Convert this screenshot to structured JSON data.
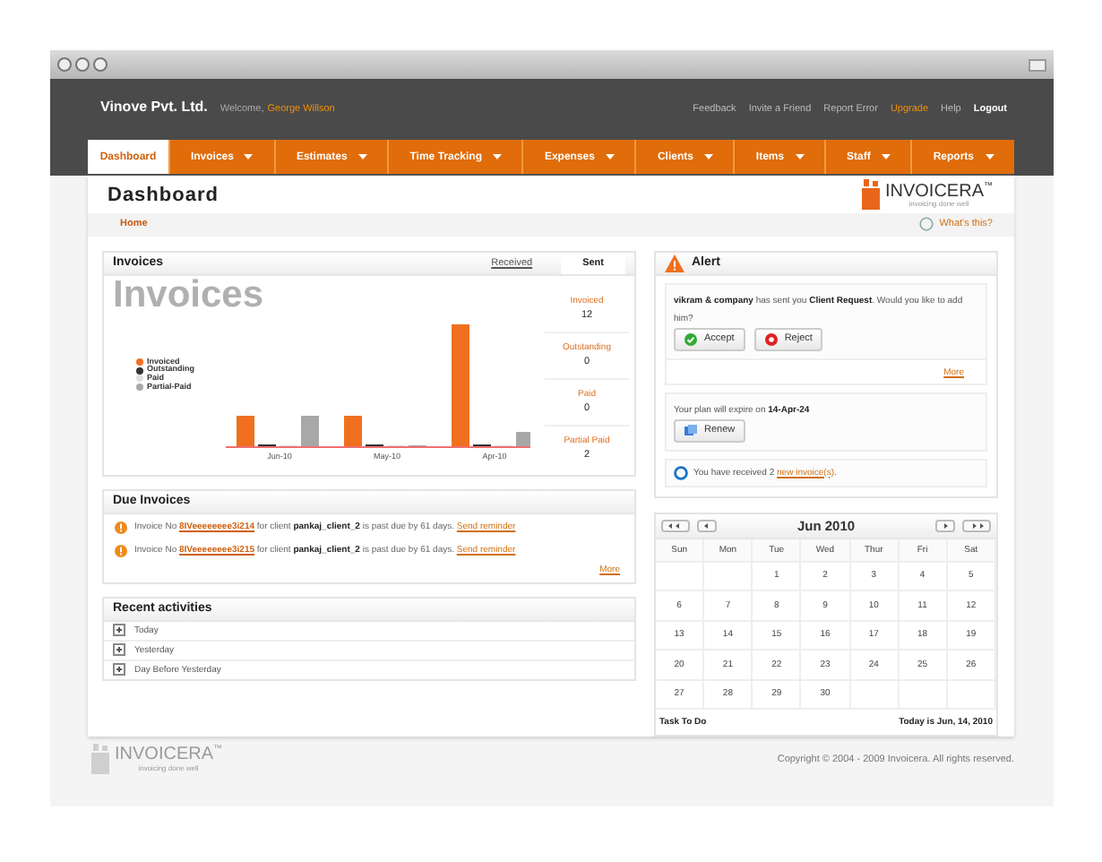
{
  "header": {
    "company": "Vinove Pvt. Ltd.",
    "welcome": "Welcome,",
    "user": "George Willson",
    "links": [
      {
        "label": "Feedback",
        "kind": "plain"
      },
      {
        "label": "Invite a Friend",
        "kind": "plain"
      },
      {
        "label": "Report Error",
        "kind": "plain"
      },
      {
        "label": "Upgrade",
        "kind": "accent"
      },
      {
        "label": "Help",
        "kind": "plain"
      },
      {
        "label": "Logout",
        "kind": "strong"
      }
    ]
  },
  "nav": [
    {
      "label": "Dashboard",
      "selected": true,
      "dropdown": false
    },
    {
      "label": "Invoices",
      "selected": false,
      "dropdown": true
    },
    {
      "label": "Estimates",
      "selected": false,
      "dropdown": true
    },
    {
      "label": "Time Tracking",
      "selected": false,
      "dropdown": true
    },
    {
      "label": "Expenses",
      "selected": false,
      "dropdown": true
    },
    {
      "label": "Clients",
      "selected": false,
      "dropdown": true
    },
    {
      "label": "Items",
      "selected": false,
      "dropdown": true
    },
    {
      "label": "Staff",
      "selected": false,
      "dropdown": true
    },
    {
      "label": "Reports",
      "selected": false,
      "dropdown": true
    }
  ],
  "page_title": "Dashboard",
  "logo": {
    "name": "INVOICERA",
    "tm": "™",
    "tagline": "invoicing done well"
  },
  "breadcrumb": "Home",
  "help_link": "What's this?",
  "invoices": {
    "title": "Invoices",
    "tabs": [
      {
        "label": "Received",
        "selected": false
      },
      {
        "label": "Sent",
        "selected": true
      }
    ],
    "chart": {
      "watermark": "Invoices",
      "categories": [
        "Jun-10",
        "May-10",
        "Apr-10"
      ],
      "legend": [
        {
          "label": "Invoiced",
          "color": "#f07020"
        },
        {
          "label": "Outstanding",
          "color": "#333333"
        },
        {
          "label": "Paid",
          "color": "#e0e0e0"
        },
        {
          "label": "Partial-Paid",
          "color": "#a8a8a8"
        }
      ]
    },
    "stats": [
      {
        "label": "Invoiced",
        "value": "12"
      },
      {
        "label": "Outstanding",
        "value": "0"
      },
      {
        "label": "Paid",
        "value": "0"
      },
      {
        "label": "Partial Paid",
        "value": "2"
      }
    ]
  },
  "due_invoices": {
    "title": "Due Invoices",
    "items": [
      {
        "prefix": "Invoice No",
        "invoice_no": "8IVeeeeeeee3i214",
        "text": "for client **pankaj_client_2** is past due by 61 days.",
        "action": "Send reminder"
      },
      {
        "prefix": "Invoice No",
        "invoice_no": "8IVeeeeeeee3i215",
        "text": "for client **pankaj_client_2** is past due by 61 days.",
        "action": "Send reminder"
      }
    ],
    "more": "More"
  },
  "recent": {
    "title": "Recent activities",
    "items": [
      {
        "label": "Today",
        "expanded": false
      },
      {
        "label": "Yesterday",
        "expanded": false
      },
      {
        "label": "Day Before Yesterday",
        "expanded": false
      }
    ]
  },
  "alert": {
    "title": "Alert",
    "message": "**vikram & company** has sent you **Client Request**. Would you like to add him?",
    "accept": "Accept",
    "reject": "Reject",
    "more": "More",
    "plan": "Your plan will expire on **14-Apr-24**",
    "renew": "Renew",
    "received_prefix": "You have received 2",
    "received_link": "new invoice(s)",
    "received_suffix": "."
  },
  "calendar": {
    "month": "Jun 2010",
    "weekdays": [
      "Sun",
      "Mon",
      "Tue",
      "Wed",
      "Thur",
      "Fri",
      "Sat"
    ],
    "weeks": [
      {
        "kind": "first",
        "days": [
          "1",
          "2",
          "3",
          "4",
          "5"
        ]
      },
      {
        "kind": "full",
        "days": [
          "6",
          "7",
          "8",
          "9",
          "10",
          "11",
          "12"
        ]
      },
      {
        "kind": "full",
        "days": [
          "13",
          "14",
          "15",
          "16",
          "17",
          "18",
          "19"
        ]
      },
      {
        "kind": "full",
        "days": [
          "20",
          "21",
          "22",
          "23",
          "24",
          "25",
          "26"
        ]
      },
      {
        "kind": "last",
        "days": [
          "27",
          "28",
          "29",
          "30"
        ]
      }
    ],
    "task_label": "Task To Do",
    "today": "Today is Jun, 14, 2010"
  },
  "footer": {
    "logo": "INVOICERA",
    "tm": "™",
    "tagline": "invoicing done well",
    "copyright": "Copyright © 2004 - 2009 Invoicera. All rights reserved."
  }
}
